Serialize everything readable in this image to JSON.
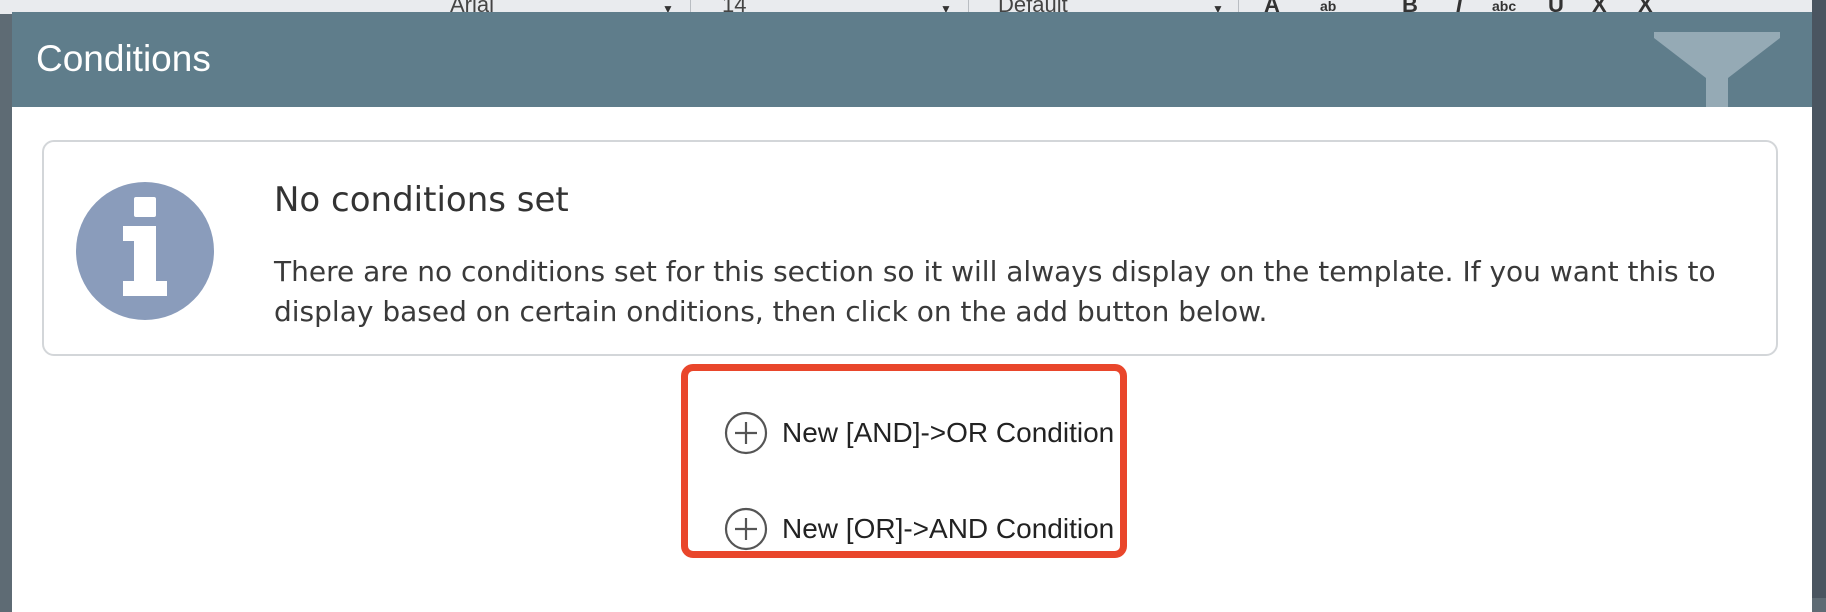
{
  "background_toolbar": {
    "font_name": "Arial",
    "font_size": "14",
    "style": "Default"
  },
  "modal": {
    "title": "Conditions",
    "header_icon": "filter-icon",
    "colors": {
      "header": "#5f7d8b",
      "info_icon": "#8a9cbb",
      "highlight": "#e9462b"
    }
  },
  "info": {
    "icon": "info-icon",
    "heading": "No conditions set",
    "body": "There are no conditions set for this section so it will always display on the template. If you want this to display based on certain onditions, then click on the add button below."
  },
  "actions": [
    {
      "icon": "plus-circle-icon",
      "label": "New [AND]->OR Condition"
    },
    {
      "icon": "plus-circle-icon",
      "label": "New [OR]->AND Condition"
    }
  ]
}
